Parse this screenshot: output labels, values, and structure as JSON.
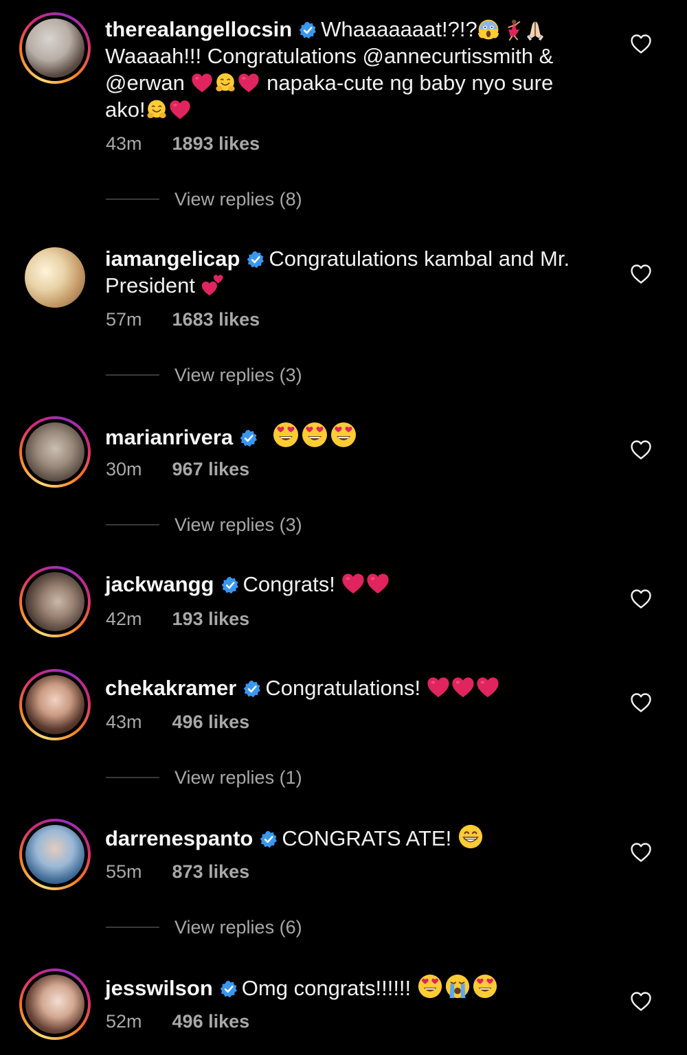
{
  "comments": [
    {
      "username": "therealangellocsin",
      "verified": true,
      "text_parts": [
        "Whaaaaaaat!?!?",
        "Waaaah!!! Congratulations @annecurtissmith &",
        "@erwan",
        "napaka-cute ng baby nyo sure",
        "ako!"
      ],
      "time": "43m",
      "likes": "1893 likes",
      "replies": "View replies (8)"
    },
    {
      "username": "iamangelicap",
      "verified": true,
      "text_parts": [
        "Congratulations kambal and Mr.",
        "President"
      ],
      "time": "57m",
      "likes": "1683 likes",
      "replies": "View replies (3)"
    },
    {
      "username": "marianrivera",
      "verified": true,
      "text_parts": [],
      "time": "30m",
      "likes": "967 likes",
      "replies": "View replies (3)"
    },
    {
      "username": "jackwangg",
      "verified": true,
      "text_parts": [
        "Congrats!"
      ],
      "time": "42m",
      "likes": "193 likes",
      "replies": ""
    },
    {
      "username": "chekakramer",
      "verified": true,
      "text_parts": [
        "Congratulations!"
      ],
      "time": "43m",
      "likes": "496 likes",
      "replies": "View replies (1)"
    },
    {
      "username": "darrenespanto",
      "verified": true,
      "text_parts": [
        "CONGRATS ATE!"
      ],
      "time": "55m",
      "likes": "873 likes",
      "replies": "View replies (6)"
    },
    {
      "username": "jesswilson",
      "verified": true,
      "text_parts": [
        "Omg congrats!!!!!!"
      ],
      "time": "52m",
      "likes": "496 likes",
      "replies": ""
    }
  ],
  "colors": {
    "background": "#000000",
    "text": "#f2f2f2",
    "muted": "#a8a8a8",
    "verified_badge": "#3897f0",
    "heart_emoji": "#e0245e"
  }
}
